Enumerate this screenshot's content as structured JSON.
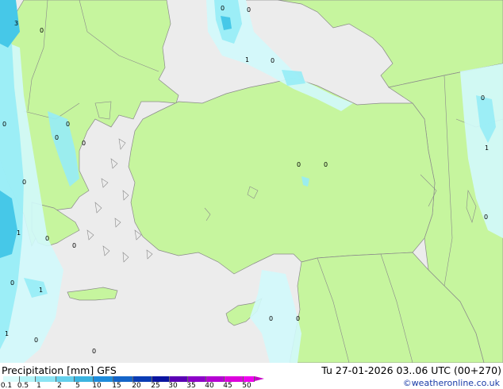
{
  "map": {
    "colors": {
      "land": "#c6f59e",
      "sea": "#ececec",
      "coast": "#8a8a8a",
      "precip_light": "#d2fafc",
      "precip_mid": "#96ecf6",
      "precip_heavy": "#46c8e8"
    },
    "contour_labels": [
      "3",
      "0",
      "0",
      "0",
      "0",
      "1",
      "0",
      "0",
      "0",
      "0",
      "0",
      "0",
      "0",
      "1",
      "0",
      "0",
      "1",
      "0",
      "0",
      "1",
      "0",
      "1",
      "0",
      "0",
      "0",
      "0"
    ]
  },
  "footer": {
    "title": "Precipitation [mm]",
    "model": "GFS",
    "valid_time": "Tu 27-01-2026 03..06 UTC (00+270)",
    "credit": "©weatheronline.co.uk"
  },
  "legend": {
    "ticks": [
      "0.1",
      "0.5",
      "1",
      "2",
      "5",
      "10",
      "15",
      "20",
      "25",
      "30",
      "35",
      "40",
      "45",
      "50"
    ],
    "colors": [
      "#dcfcfc",
      "#b4f4f8",
      "#8ce4f4",
      "#64d0ec",
      "#3cb4e0",
      "#1e8cdc",
      "#1464c8",
      "#0a3cb4",
      "#0a14a0",
      "#5a00b4",
      "#8c00c8",
      "#b400d2",
      "#dc00dc",
      "#f000f0"
    ]
  }
}
